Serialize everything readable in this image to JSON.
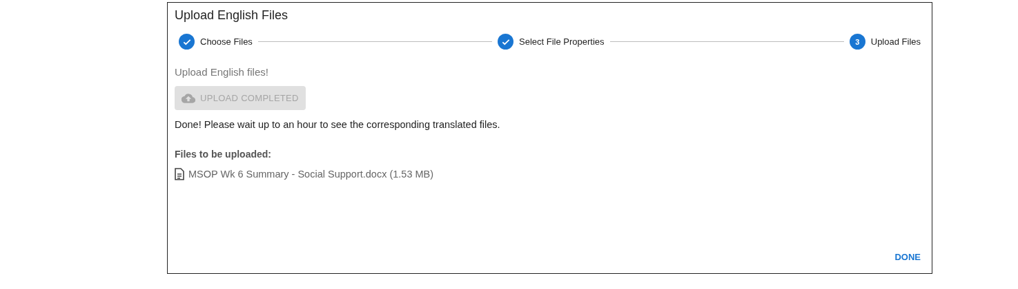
{
  "dialog": {
    "title": "Upload English Files"
  },
  "steps": [
    {
      "label": "Choose Files",
      "completed": true
    },
    {
      "label": "Select File Properties",
      "completed": true
    },
    {
      "label": "Upload Files",
      "completed": false,
      "number": "3"
    }
  ],
  "field": {
    "placeholder": "Upload English files!"
  },
  "upload_button": {
    "label": "UPLOAD COMPLETED",
    "disabled": true
  },
  "message": "Done! Please wait up to an hour to see the corresponding translated files.",
  "files_heading": "Files to be uploaded:",
  "files": [
    "MSOP Wk 6 Summary - Social Support.docx (1.53 MB)"
  ],
  "actions": [
    "DONE"
  ]
}
